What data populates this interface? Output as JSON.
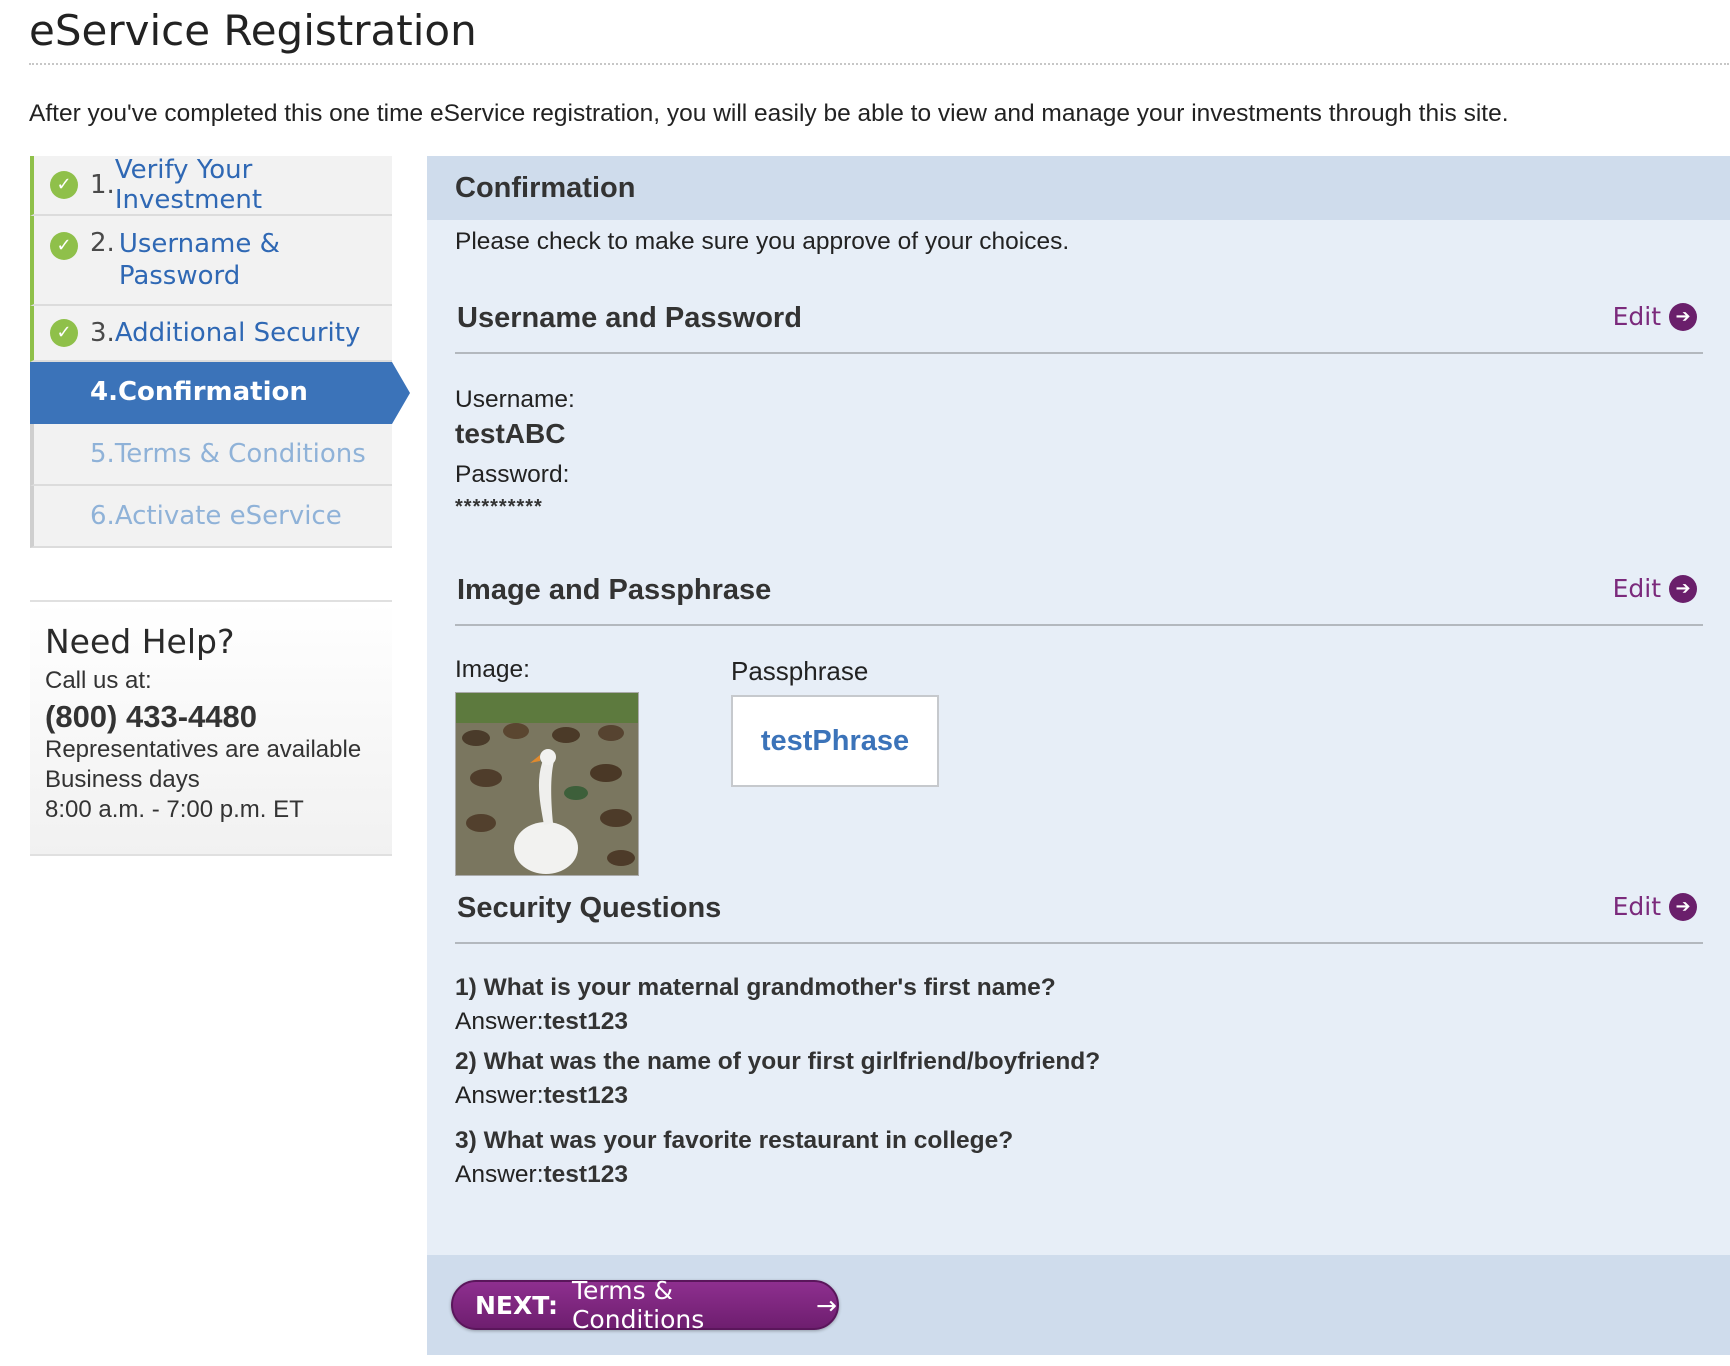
{
  "page": {
    "title": "eService Registration",
    "intro": "After you've completed this one time eService registration, you will easily be able to view and manage your investments through this site."
  },
  "steps": [
    {
      "num": "1.",
      "label": "Verify Your Investment",
      "state": "done"
    },
    {
      "num": "2.",
      "label": "Username &",
      "label2": "Password",
      "state": "done"
    },
    {
      "num": "3.",
      "label": "Additional Security",
      "state": "done"
    },
    {
      "num": "4.",
      "label": "Confirmation",
      "state": "current"
    },
    {
      "num": "5.",
      "label": "Terms & Conditions",
      "state": "future"
    },
    {
      "num": "6.",
      "label": "Activate eService",
      "state": "future"
    }
  ],
  "help": {
    "title": "Need Help?",
    "call": "Call us at:",
    "phone": "(800) 433-4480",
    "line1": "Representatives are available",
    "line2": "Business days",
    "line3": "8:00 a.m. - 7:00 p.m. ET"
  },
  "panel": {
    "title": "Confirmation",
    "subtitle": "Please check to make sure you approve of your choices.",
    "edit_label": "Edit",
    "sections": {
      "credentials": {
        "title": "Username and Password",
        "username_label": "Username:",
        "username_value": "testABC",
        "password_label": "Password:",
        "password_value": "**********"
      },
      "image": {
        "title": "Image and Passphrase",
        "image_label": "Image:",
        "passphrase_label": "Passphrase",
        "passphrase_value": "testPhrase"
      },
      "security": {
        "title": "Security Questions",
        "answer_prefix": "Answer:",
        "questions": [
          {
            "q": "1) What is your maternal grandmother's first name?",
            "a": "test123"
          },
          {
            "q": "2) What was the name of your first girlfriend/boyfriend?",
            "a": "test123"
          },
          {
            "q": "3) What was your favorite restaurant in college?",
            "a": "test123"
          }
        ]
      }
    },
    "next": {
      "prefix": "NEXT:",
      "label": "Terms & Conditions"
    }
  },
  "colors": {
    "primary_blue": "#3b73b9",
    "check_green": "#8fc04a",
    "purple": "#7b2a7c",
    "panel_bg": "#e7eef7",
    "panel_header_bg": "#cfdcec"
  },
  "icons": {
    "check": "check-circle-icon",
    "edit_arrow": "arrow-right-circle-icon",
    "next_arrow": "arrow-right-icon"
  }
}
